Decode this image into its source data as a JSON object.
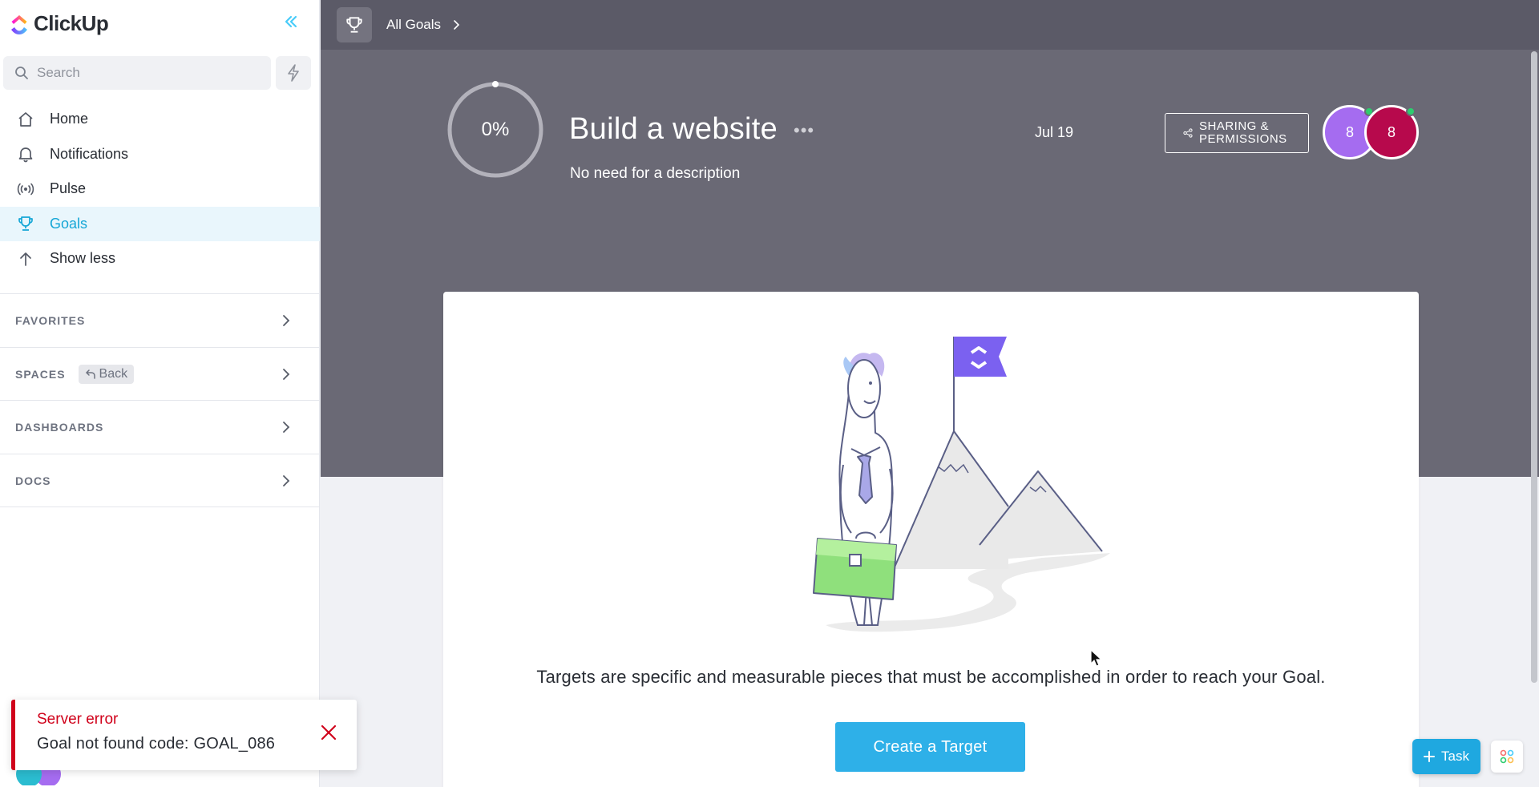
{
  "app": {
    "name": "ClickUp"
  },
  "sidebar": {
    "search_placeholder": "Search",
    "nav": [
      {
        "label": "Home",
        "icon": "home-icon"
      },
      {
        "label": "Notifications",
        "icon": "bell-icon"
      },
      {
        "label": "Pulse",
        "icon": "pulse-icon"
      },
      {
        "label": "Goals",
        "icon": "trophy-icon",
        "active": true
      },
      {
        "label": "Show less",
        "icon": "arrow-up-icon"
      }
    ],
    "sections": {
      "favorites": "FAVORITES",
      "spaces": "SPACES",
      "spaces_back": "Back",
      "dashboards": "DASHBOARDS",
      "docs": "DOCS"
    }
  },
  "toast": {
    "title": "Server error",
    "message": "Goal not found code: GOAL_086"
  },
  "topbar": {
    "breadcrumb": "All Goals"
  },
  "goal": {
    "progress_label": "0%",
    "progress": 0,
    "title": "Build a website",
    "more": "•••",
    "description": "No need for a description",
    "due_date": "Jul 19",
    "share_line1": "SHARING &",
    "share_line2": "PERMISSIONS",
    "avatars": [
      "8",
      "8"
    ]
  },
  "empty_state": {
    "text": "Targets are specific and measurable pieces that must be accomplished in order to reach your Goal.",
    "cta": "Create a Target"
  },
  "fab": {
    "task_label": "Task"
  },
  "colors": {
    "accent": "#49ccf9",
    "active_nav": "#15a6d6",
    "header_bg": "#6a6975",
    "topbar_bg": "#5b5a67",
    "error": "#d0021b",
    "cta": "#2eb0e8",
    "avatar1": "#a56cf0",
    "avatar2": "#b7094c"
  }
}
